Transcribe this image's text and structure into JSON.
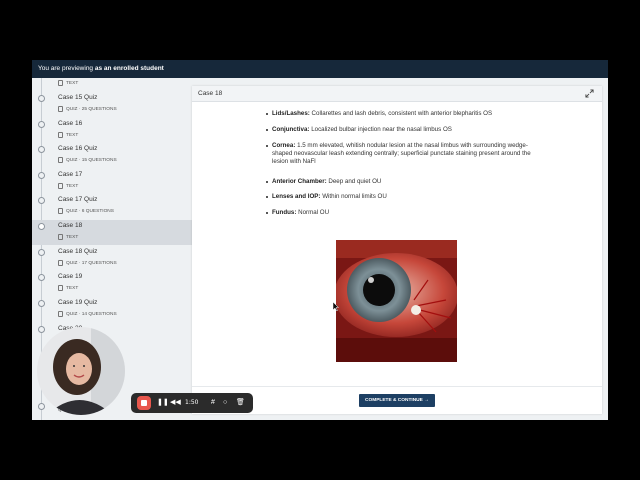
{
  "banner": {
    "prefix": "You are previewing",
    "strong": "as an enrolled student"
  },
  "sidebar": {
    "items": [
      {
        "title": "",
        "sub": "TEXT"
      },
      {
        "title": "Case 15 Quiz",
        "sub": "QUIZ · 25 QUESTIONS"
      },
      {
        "title": "Case 16",
        "sub": "TEXT"
      },
      {
        "title": "Case 16 Quiz",
        "sub": "QUIZ · 15 QUESTIONS"
      },
      {
        "title": "Case 17",
        "sub": "TEXT"
      },
      {
        "title": "Case 17 Quiz",
        "sub": "QUIZ · 6 QUESTIONS"
      },
      {
        "title": "Case 18",
        "sub": "TEXT"
      },
      {
        "title": "Case 18 Quiz",
        "sub": "QUIZ · 17 QUESTIONS"
      },
      {
        "title": "Case 19",
        "sub": "TEXT"
      },
      {
        "title": "Case 19 Quiz",
        "sub": "QUIZ · 14 QUESTIONS"
      },
      {
        "title": "Case 20",
        "sub": ""
      },
      {
        "title": "",
        "sub": "QUESTIONS"
      }
    ],
    "active_index": 6
  },
  "panel": {
    "title": "Case 18",
    "findings": [
      {
        "label": "Lids/Lashes:",
        "text": " Collarettes and lash debris, consistent with anterior blepharitis OS"
      },
      {
        "label": "Conjunctiva:",
        "text": " Localized bulbar injection near the nasal limbus OS"
      },
      {
        "label": "Cornea:",
        "text": " 1.5 mm elevated, whitish nodular lesion at the nasal limbus with surrounding wedge-shaped neovascular leash extending centrally; superficial punctate staining present around the lesion with NaFl"
      },
      {
        "label": "Anterior Chamber:",
        "text": " Deep and quiet OU"
      },
      {
        "label": "Lenses and IOP:",
        "text": " Within normal limits OU"
      },
      {
        "label": "Fundus:",
        "text": " Normal OU"
      }
    ],
    "continue_label": "COMPLETE & CONTINUE →"
  },
  "recorder": {
    "time": "1:50"
  },
  "icons": {
    "expand": "expand-icon",
    "doc": "text-doc-icon",
    "quiz": "quiz-doc-icon",
    "stop": "stop-icon",
    "pause": "pause-icon",
    "rewind": "rewind-icon",
    "grid": "grid-icon",
    "circle": "circle-icon",
    "trash": "trash-icon"
  },
  "colors": {
    "banner": "#16283a",
    "button": "#1d3f63",
    "record": "#e8574d"
  }
}
